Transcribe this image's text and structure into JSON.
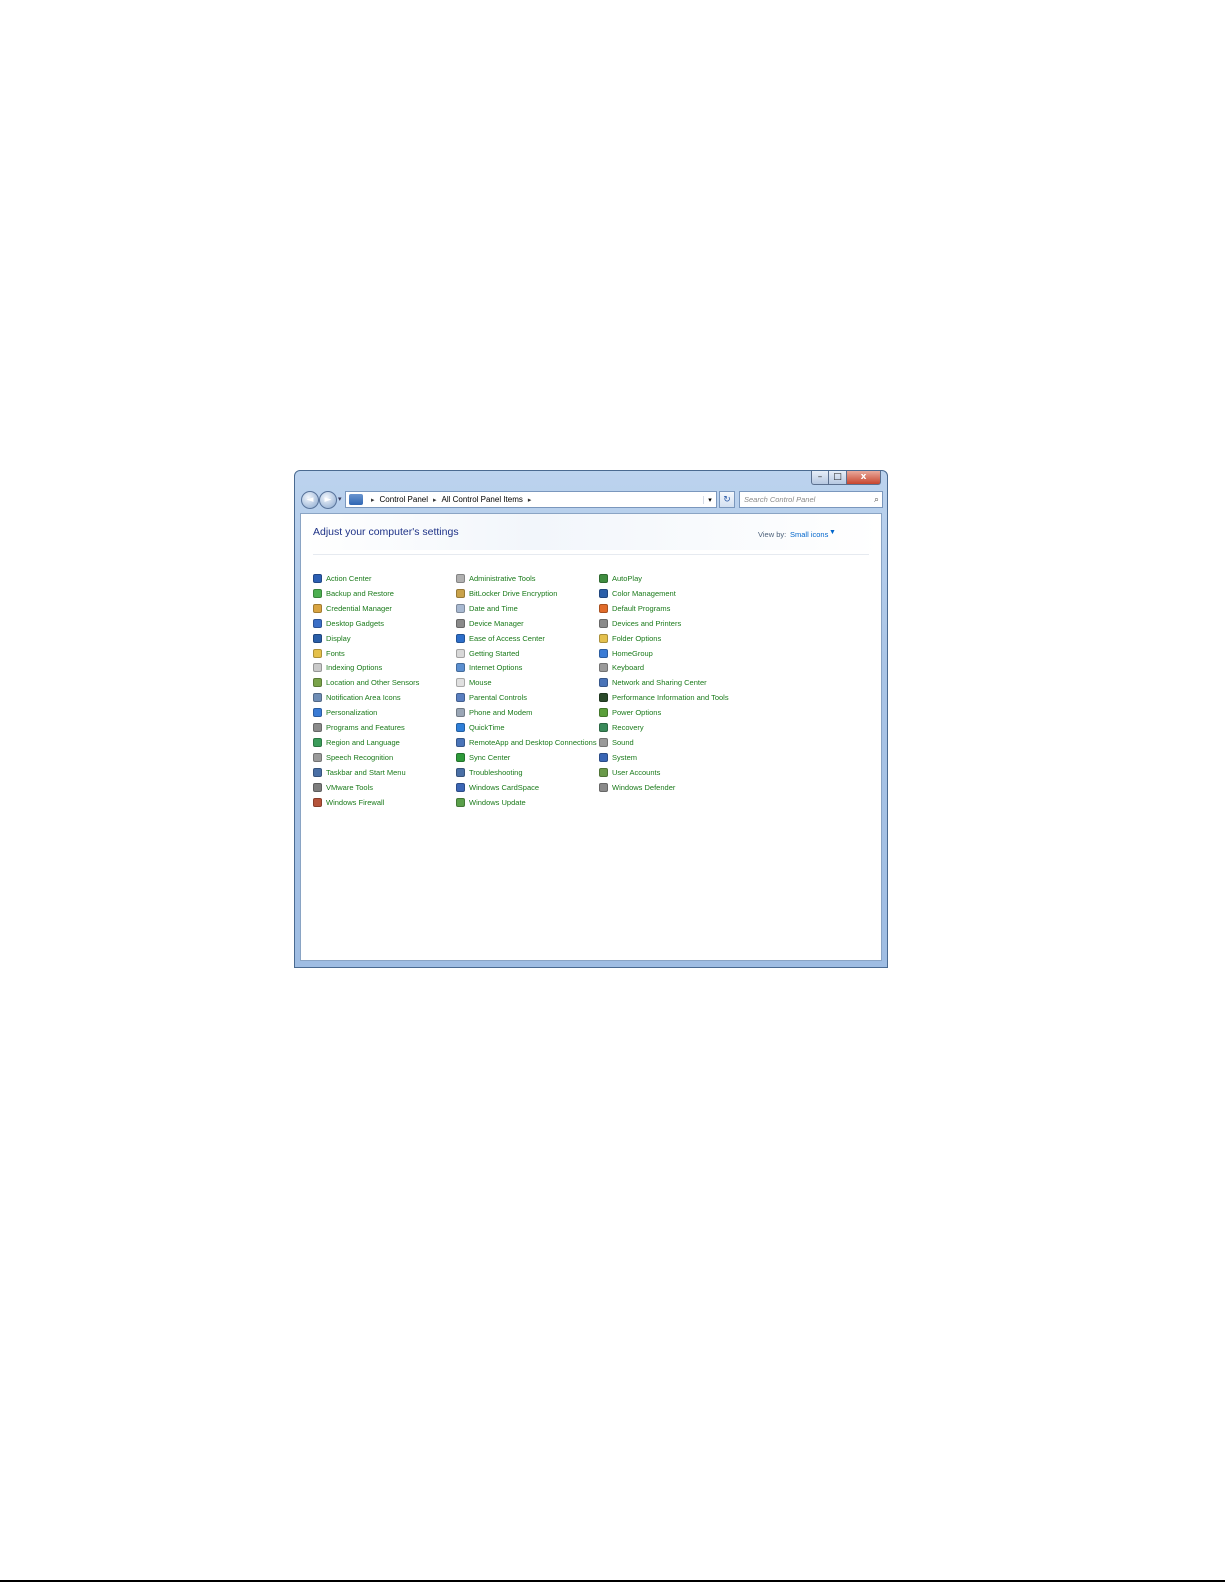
{
  "window": {
    "caption_buttons": {
      "minimize": "–",
      "maximize": "□",
      "close": "x"
    }
  },
  "nav": {
    "back": "◄",
    "forward": "►",
    "recent": "▾"
  },
  "addressbar": {
    "breadcrumbs": [
      "Control Panel",
      "All Control Panel Items"
    ],
    "separator": "▸",
    "dropdown": "▾"
  },
  "refresh": "↻",
  "search": {
    "placeholder": "Search Control Panel",
    "icon": "⌕"
  },
  "header": {
    "title": "Adjust your computer's settings",
    "view_by_label": "View by:",
    "view_by_value": "Small icons",
    "view_by_caret": "▼"
  },
  "accent_color": "#1a7a1a",
  "title_color": "#1e3287",
  "columns": [
    {
      "items": [
        {
          "label": "Action Center",
          "icon": "flag-icon",
          "color": "#2c5fb3"
        },
        {
          "label": "Backup and Restore",
          "icon": "backup-icon",
          "color": "#4caf50"
        },
        {
          "label": "Credential Manager",
          "icon": "vault-icon",
          "color": "#d9a441"
        },
        {
          "label": "Desktop Gadgets",
          "icon": "gadgets-icon",
          "color": "#3b6fc7"
        },
        {
          "label": "Display",
          "icon": "monitor-icon",
          "color": "#2a5ea8"
        },
        {
          "label": "Fonts",
          "icon": "fonts-icon",
          "color": "#e4c04a"
        },
        {
          "label": "Indexing Options",
          "icon": "indexing-icon",
          "color": "#c9c9c9"
        },
        {
          "label": "Location and Other Sensors",
          "icon": "sensors-icon",
          "color": "#7aa34a"
        },
        {
          "label": "Notification Area Icons",
          "icon": "notification-icon",
          "color": "#6f8db5"
        },
        {
          "label": "Personalization",
          "icon": "personalization-icon",
          "color": "#3a7bd5"
        },
        {
          "label": "Programs and Features",
          "icon": "programs-icon",
          "color": "#8a8a8a"
        },
        {
          "label": "Region and Language",
          "icon": "globe-icon",
          "color": "#3b9c5a"
        },
        {
          "label": "Speech Recognition",
          "icon": "microphone-icon",
          "color": "#9a9a9a"
        },
        {
          "label": "Taskbar and Start Menu",
          "icon": "taskbar-icon",
          "color": "#4a6fa5"
        },
        {
          "label": "VMware Tools",
          "icon": "vmware-icon",
          "color": "#7d7d7d"
        },
        {
          "label": "Windows Firewall",
          "icon": "firewall-icon",
          "color": "#b5533a"
        }
      ]
    },
    {
      "items": [
        {
          "label": "Administrative Tools",
          "icon": "admin-tools-icon",
          "color": "#b0b0b0"
        },
        {
          "label": "BitLocker Drive Encryption",
          "icon": "bitlocker-icon",
          "color": "#c9a24a"
        },
        {
          "label": "Date and Time",
          "icon": "clock-icon",
          "color": "#a8b9d1"
        },
        {
          "label": "Device Manager",
          "icon": "device-manager-icon",
          "color": "#8a8a8a"
        },
        {
          "label": "Ease of Access Center",
          "icon": "ease-of-access-icon",
          "color": "#2d6ec9"
        },
        {
          "label": "Getting Started",
          "icon": "getting-started-icon",
          "color": "#d8d8d8"
        },
        {
          "label": "Internet Options",
          "icon": "internet-icon",
          "color": "#5b8fd0"
        },
        {
          "label": "Mouse",
          "icon": "mouse-icon",
          "color": "#e0e0e0"
        },
        {
          "label": "Parental Controls",
          "icon": "parental-icon",
          "color": "#5a7fc0"
        },
        {
          "label": "Phone and Modem",
          "icon": "phone-icon",
          "color": "#9aa6b5"
        },
        {
          "label": "QuickTime",
          "icon": "quicktime-icon",
          "color": "#2f7fd8"
        },
        {
          "label": "RemoteApp and Desktop Connections",
          "icon": "remoteapp-icon",
          "color": "#4a74b8"
        },
        {
          "label": "Sync Center",
          "icon": "sync-icon",
          "color": "#2e9a3a"
        },
        {
          "label": "Troubleshooting",
          "icon": "troubleshooting-icon",
          "color": "#4a6fa5"
        },
        {
          "label": "Windows CardSpace",
          "icon": "cardspace-icon",
          "color": "#3c66b5"
        },
        {
          "label": "Windows Update",
          "icon": "update-icon",
          "color": "#5a9f4a"
        }
      ]
    },
    {
      "items": [
        {
          "label": "AutoPlay",
          "icon": "autoplay-icon",
          "color": "#3f8c3f"
        },
        {
          "label": "Color Management",
          "icon": "color-management-icon",
          "color": "#2b5ea8"
        },
        {
          "label": "Default Programs",
          "icon": "default-programs-icon",
          "color": "#e06b2a"
        },
        {
          "label": "Devices and Printers",
          "icon": "printer-icon",
          "color": "#8a8a8a"
        },
        {
          "label": "Folder Options",
          "icon": "folder-icon",
          "color": "#e3c04e"
        },
        {
          "label": "HomeGroup",
          "icon": "homegroup-icon",
          "color": "#3a7bd5"
        },
        {
          "label": "Keyboard",
          "icon": "keyboard-icon",
          "color": "#9a9a9a"
        },
        {
          "label": "Network and Sharing Center",
          "icon": "network-icon",
          "color": "#4a74b8"
        },
        {
          "label": "Performance Information and Tools",
          "icon": "performance-icon",
          "color": "#2a4a2a"
        },
        {
          "label": "Power Options",
          "icon": "power-icon",
          "color": "#5a9f3a"
        },
        {
          "label": "Recovery",
          "icon": "recovery-icon",
          "color": "#3a8a5a"
        },
        {
          "label": "Sound",
          "icon": "speaker-icon",
          "color": "#9a9a9a"
        },
        {
          "label": "System",
          "icon": "system-icon",
          "color": "#3a66b5"
        },
        {
          "label": "User Accounts",
          "icon": "user-accounts-icon",
          "color": "#6a9a4a"
        },
        {
          "label": "Windows Defender",
          "icon": "defender-icon",
          "color": "#8a8a8a"
        }
      ]
    }
  ]
}
